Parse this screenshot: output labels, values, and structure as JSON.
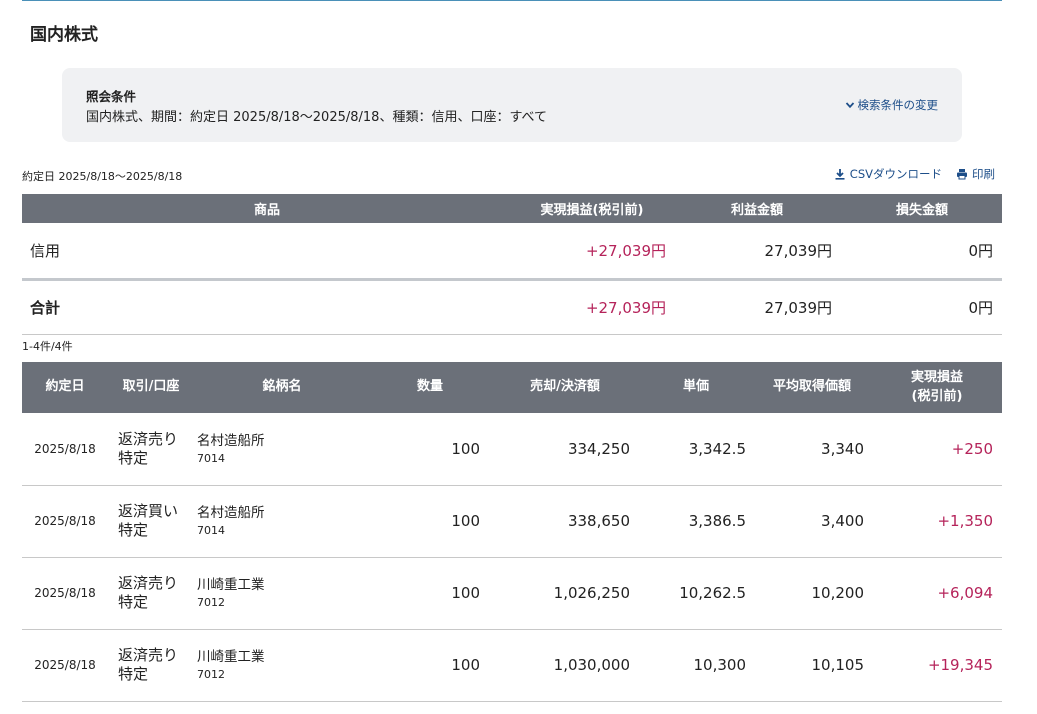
{
  "page": {
    "title": "国内株式"
  },
  "conditions": {
    "title": "照会条件",
    "text": "国内株式、期間：約定日 2025/8/18〜2025/8/18、種類：信用、口座：すべて",
    "change_link": "検索条件の変更"
  },
  "period_label": "約定日 2025/8/18〜2025/8/18",
  "tools": {
    "csv_download": "CSVダウンロード",
    "print": "印刷"
  },
  "summary": {
    "headers": [
      "商品",
      "実現損益(税引前)",
      "利益金額",
      "損失金額"
    ],
    "rows": [
      {
        "product": "信用",
        "realized_pl": "+27,039円",
        "profit": "27,039円",
        "loss": "0円"
      },
      {
        "product": "合計",
        "realized_pl": "+27,039円",
        "profit": "27,039円",
        "loss": "0円"
      }
    ]
  },
  "count_label": "1-4件/4件",
  "detail": {
    "headers": [
      "約定日",
      "取引/口座",
      "銘柄名",
      "数量",
      "売却/決済額",
      "単価",
      "平均取得価額",
      "実現損益",
      "(税引前)"
    ],
    "rows": [
      {
        "date": "2025/8/18",
        "trade": "返済売り",
        "account": "特定",
        "name": "名村造船所",
        "code": "7014",
        "qty": "100",
        "amount": "334,250",
        "unit": "3,342.5",
        "avg": "3,340",
        "pl": "+250"
      },
      {
        "date": "2025/8/18",
        "trade": "返済買い",
        "account": "特定",
        "name": "名村造船所",
        "code": "7014",
        "qty": "100",
        "amount": "338,650",
        "unit": "3,386.5",
        "avg": "3,400",
        "pl": "+1,350"
      },
      {
        "date": "2025/8/18",
        "trade": "返済売り",
        "account": "特定",
        "name": "川崎重工業",
        "code": "7012",
        "qty": "100",
        "amount": "1,026,250",
        "unit": "10,262.5",
        "avg": "10,200",
        "pl": "+6,094"
      },
      {
        "date": "2025/8/18",
        "trade": "返済売り",
        "account": "特定",
        "name": "川崎重工業",
        "code": "7012",
        "qty": "100",
        "amount": "1,030,000",
        "unit": "10,300",
        "avg": "10,105",
        "pl": "+19,345"
      }
    ]
  },
  "colors": {
    "header_bg": "#6b7079",
    "positive": "#b5235a",
    "link": "#1d4e89",
    "panel_bg": "#f0f1f3"
  },
  "icons": {
    "change": "chevron-down-icon",
    "csv": "download-icon",
    "print": "printer-icon"
  }
}
